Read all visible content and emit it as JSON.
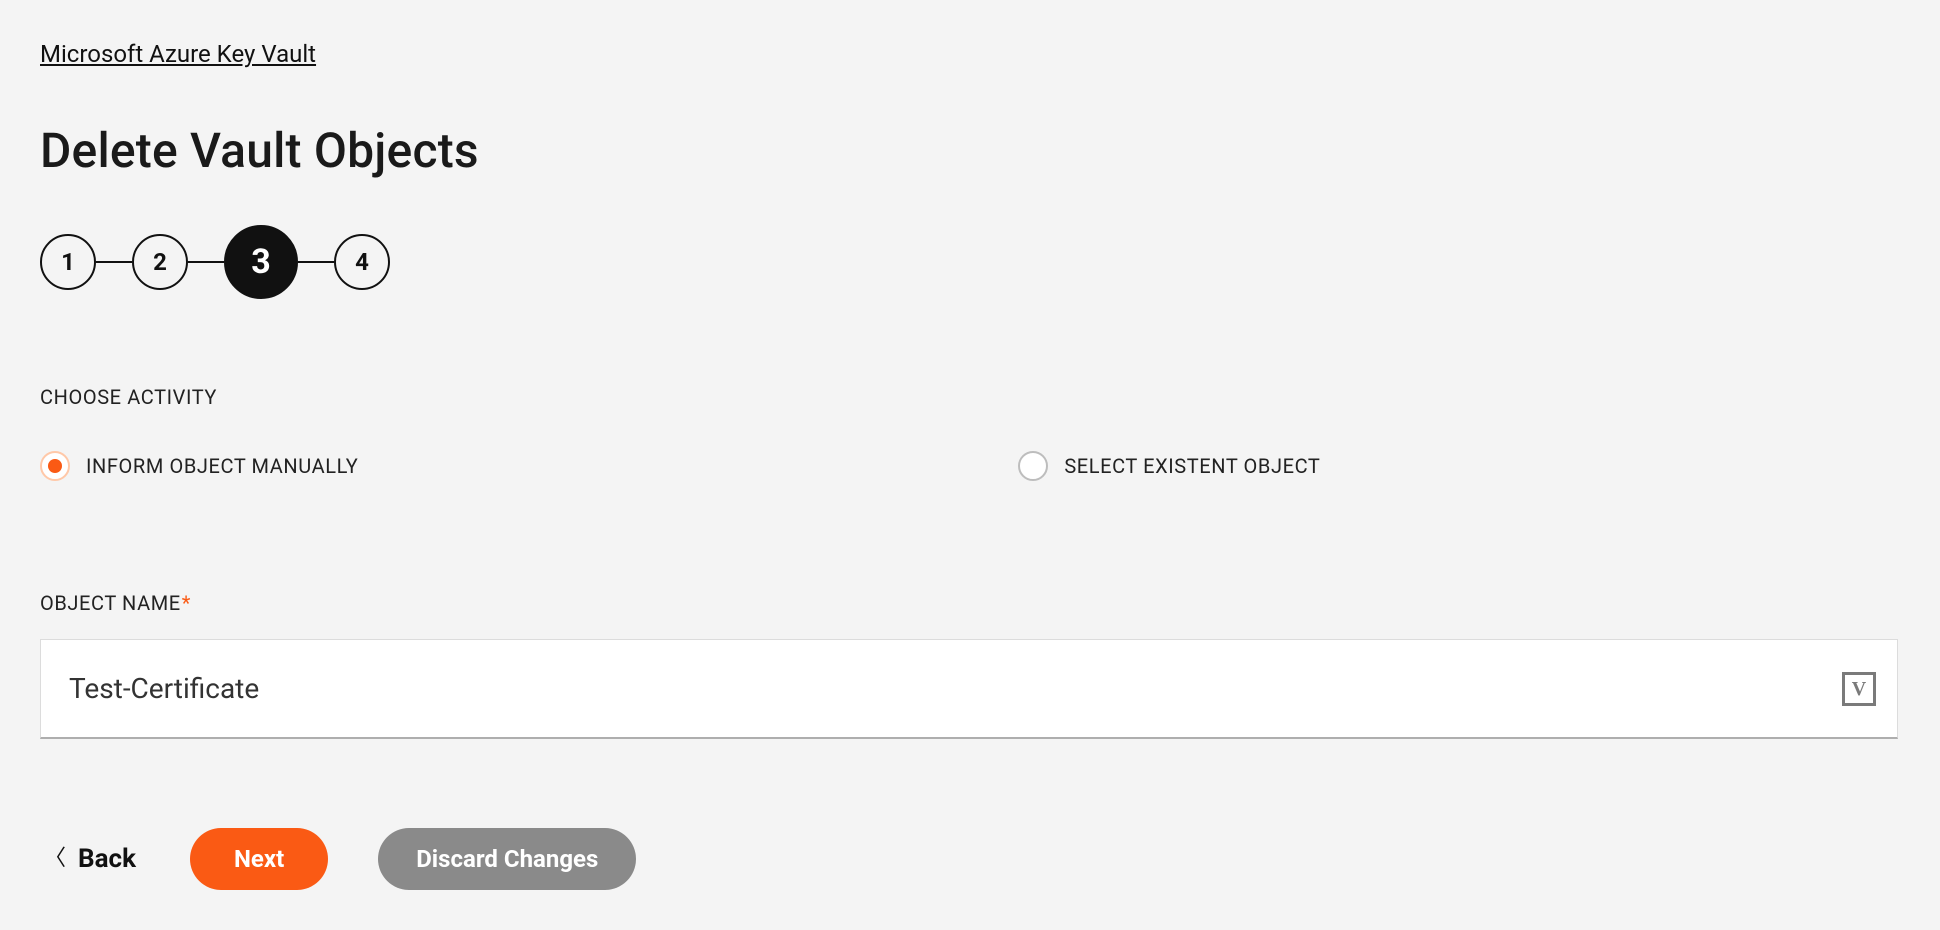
{
  "breadcrumb": {
    "label": "Microsoft Azure Key Vault"
  },
  "page": {
    "title": "Delete Vault Objects"
  },
  "stepper": {
    "steps": [
      "1",
      "2",
      "3",
      "4"
    ],
    "active_index": 2
  },
  "activity": {
    "section_label": "CHOOSE ACTIVITY",
    "options": [
      {
        "label": "INFORM OBJECT MANUALLY",
        "selected": true
      },
      {
        "label": "SELECT EXISTENT OBJECT",
        "selected": false
      }
    ]
  },
  "object_name": {
    "label": "OBJECT NAME",
    "required_mark": "*",
    "value": "Test-Certificate",
    "icon_letter": "V"
  },
  "footer": {
    "back_label": "Back",
    "next_label": "Next",
    "discard_label": "Discard Changes"
  }
}
